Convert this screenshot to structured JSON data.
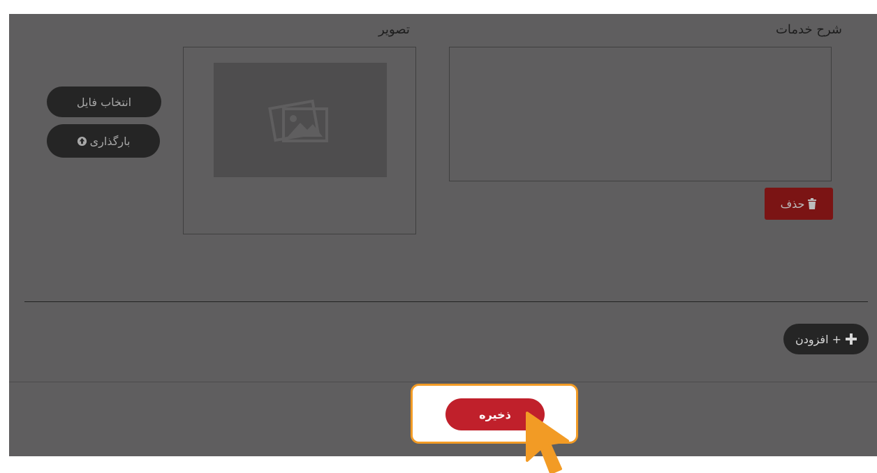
{
  "services": {
    "title": "شرح خدمات",
    "delete_label": "حذف"
  },
  "image": {
    "title": "تصویر",
    "choose_file_label": "انتخاب فایل",
    "upload_label": "بارگذاری"
  },
  "add_label": "+ افزودن",
  "save_label": "ذخیره",
  "colors": {
    "panel": "#5f5e5f",
    "delete": "#7b1414",
    "save": "#c0202b",
    "highlight_border": "#f29b25",
    "cursor": "#f29b25"
  }
}
